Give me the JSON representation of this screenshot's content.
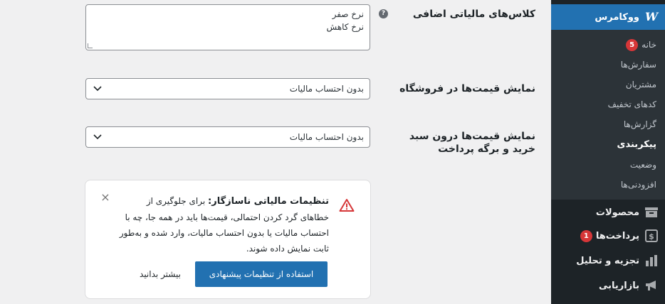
{
  "form": {
    "tax_classes_label": "کلاس‌های مالیاتی اضافی",
    "tax_classes_help": "?",
    "tax_classes_lines": [
      "نرخ صفر",
      "نرخ کاهش"
    ],
    "shop_prices_label": "نمایش قیمت‌ها در فروشگاه",
    "shop_prices_value": "بدون احتساب مالیات",
    "cart_prices_label": "نمایش قیمت‌ها درون سبد خرید و برگه پرداخت",
    "cart_prices_value": "بدون احتساب مالیات"
  },
  "notice": {
    "title": "تنظیمات مالیاتی ناسازگار:",
    "body": "برای جلوگیری از خطاهای گرد کردن احتمالی، قیمت‌ها باید در همه جا، چه با احتساب مالیات یا بدون احتساب مالیات، وارد شده و به‌طور ثابت نمایش داده شوند.",
    "primary_button": "استفاده از تنظیمات پیشنهادی",
    "secondary_button": "بیشتر بدانید",
    "close": "×"
  },
  "sidebar": {
    "woocommerce": "ووکامرس",
    "submenu": [
      {
        "label": "خانه",
        "badge": "5"
      },
      {
        "label": "سفارش‌ها"
      },
      {
        "label": "مشتریان"
      },
      {
        "label": "کدهای تخفیف"
      },
      {
        "label": "گزارش‌ها"
      },
      {
        "label": "پیکربندی",
        "current": true
      },
      {
        "label": "وضعیت"
      },
      {
        "label": "افزودنی‌ها"
      }
    ],
    "products": "محصولات",
    "payments": "پرداخت‌ها",
    "payments_badge": "1",
    "analytics": "تجزیه و تحلیل",
    "marketing": "بازاریابی"
  },
  "colors": {
    "sidebar_bg": "#1d2327",
    "submenu_bg": "#2c3338",
    "accent": "#2271b1",
    "badge": "#d63638",
    "warning": "#d63638"
  }
}
